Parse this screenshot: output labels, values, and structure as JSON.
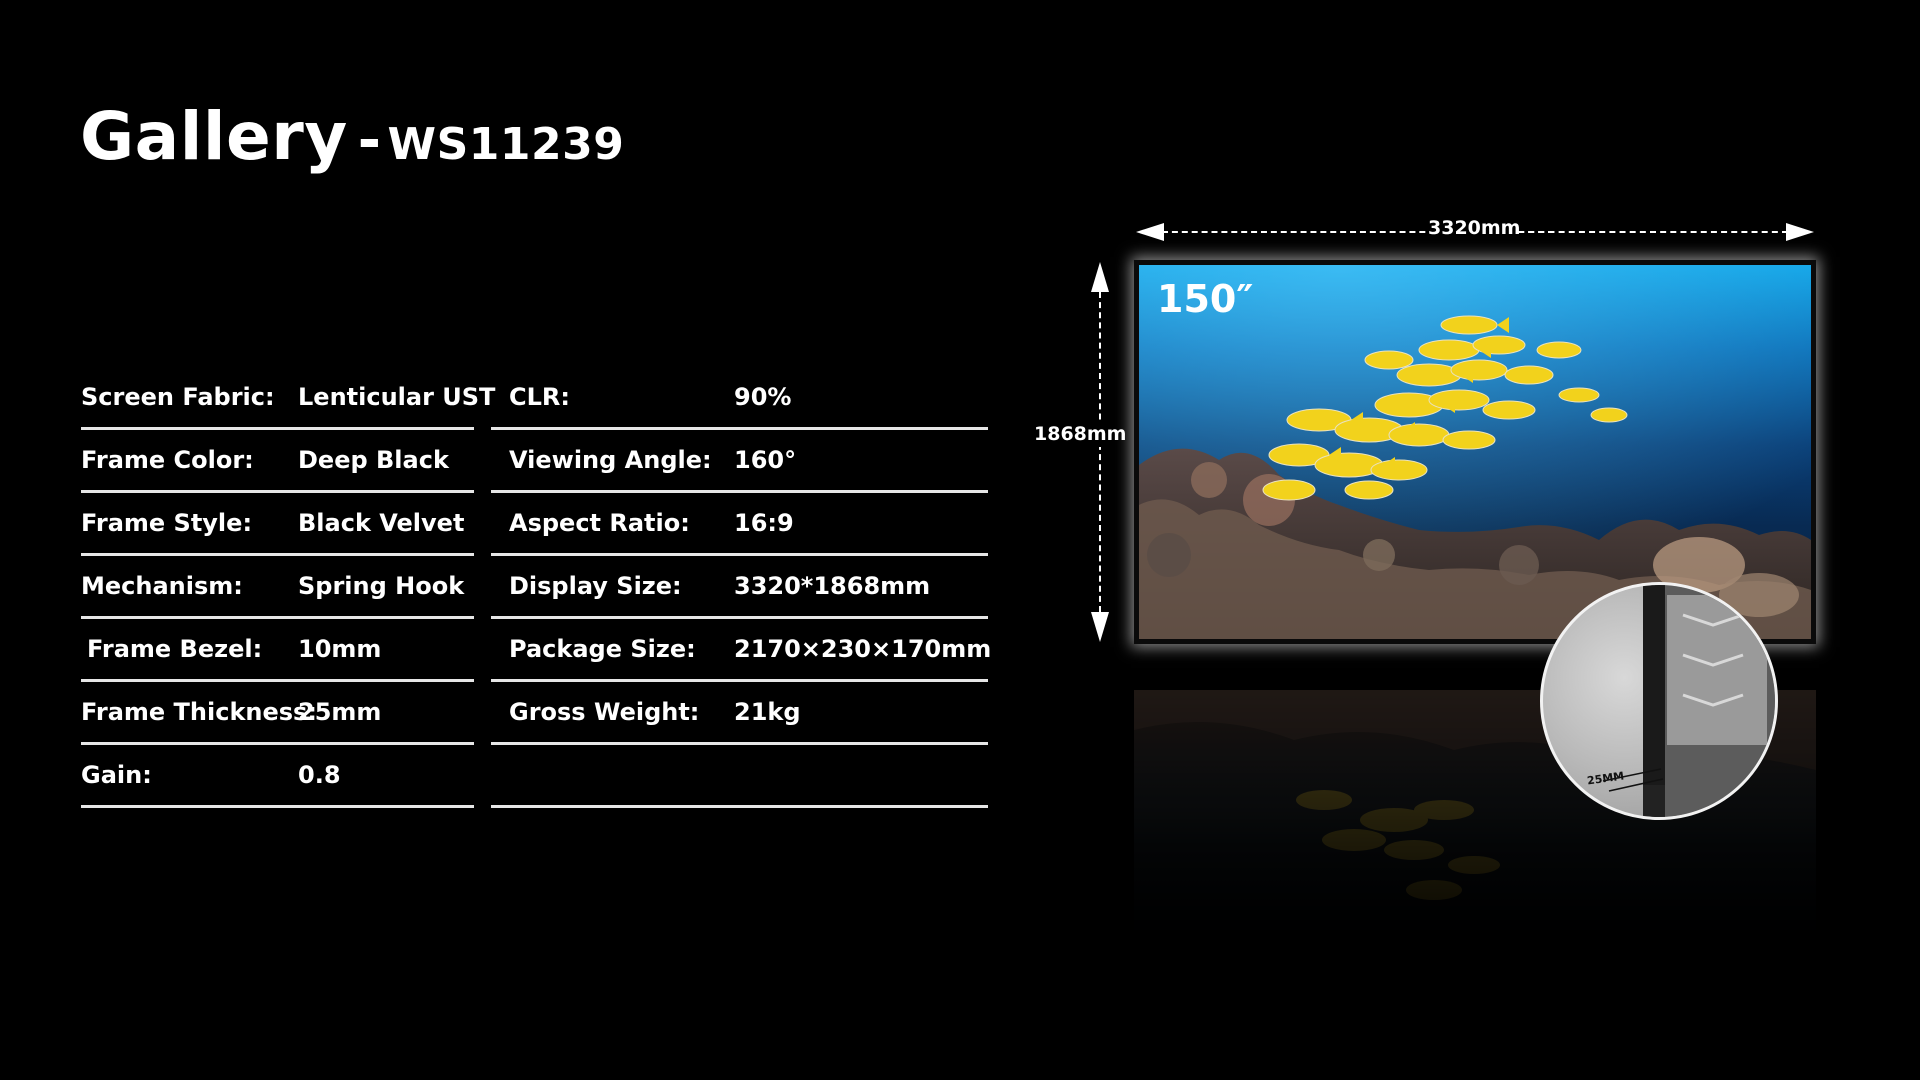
{
  "title": {
    "main": "Gallery",
    "separator": "-",
    "model": "WS11239"
  },
  "specs_left": [
    {
      "label": "Screen Fabric:",
      "value": "Lenticular UST"
    },
    {
      "label": "Frame Color:",
      "value": "Deep Black"
    },
    {
      "label": "Frame Style:",
      "value": "Black Velvet"
    },
    {
      "label": "Mechanism:",
      "value": "Spring Hook"
    },
    {
      "label": "Frame Bezel:",
      "value": "10mm"
    },
    {
      "label": "Frame Thickness:",
      "value": "25mm"
    },
    {
      "label": "Gain:",
      "value": "0.8"
    }
  ],
  "specs_right": [
    {
      "label": "CLR:",
      "value": "90%"
    },
    {
      "label": "Viewing Angle:",
      "value": "160°"
    },
    {
      "label": "Aspect Ratio:",
      "value": "16:9"
    },
    {
      "label": "Display Size:",
      "value": "3320*1868mm"
    },
    {
      "label": "Package Size:",
      "value": "2170×230×170mm"
    },
    {
      "label": "Gross Weight:",
      "value": "21kg"
    },
    {
      "label": "",
      "value": ""
    }
  ],
  "diagram": {
    "width_label": "3320mm",
    "height_label": "1868mm",
    "screen_size_label": "150″",
    "detail_label": "25MM"
  },
  "colors": {
    "background": "#000000",
    "text": "#ffffff",
    "divider": "#e6e6e6",
    "fish": "#f2d21c"
  }
}
